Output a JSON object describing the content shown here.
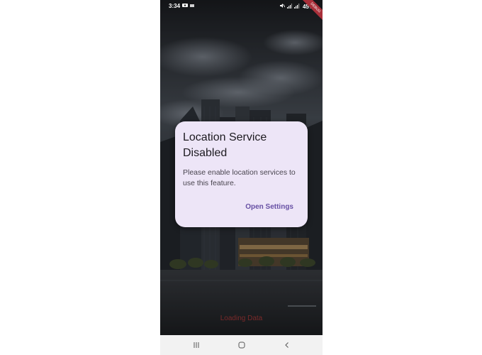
{
  "status_bar": {
    "time": "3:34",
    "battery": "45%",
    "icons": [
      "notification-icon",
      "mute-icon",
      "wifi-signal-icon",
      "cell-signal-icon",
      "battery-icon"
    ]
  },
  "debug_banner": {
    "label": "DEBUG"
  },
  "dialog": {
    "title": "Location Service Disabled",
    "message": "Please enable location services to use this feature.",
    "action_label": "Open Settings"
  },
  "background": {
    "loading_text": "Loading Data"
  },
  "nav_bar": {
    "buttons": [
      "recent-apps-icon",
      "home-icon",
      "back-icon"
    ]
  },
  "colors": {
    "dialog_bg": "#ede5f7",
    "accent": "#6750a4",
    "loading_text": "#7a2a2a"
  }
}
